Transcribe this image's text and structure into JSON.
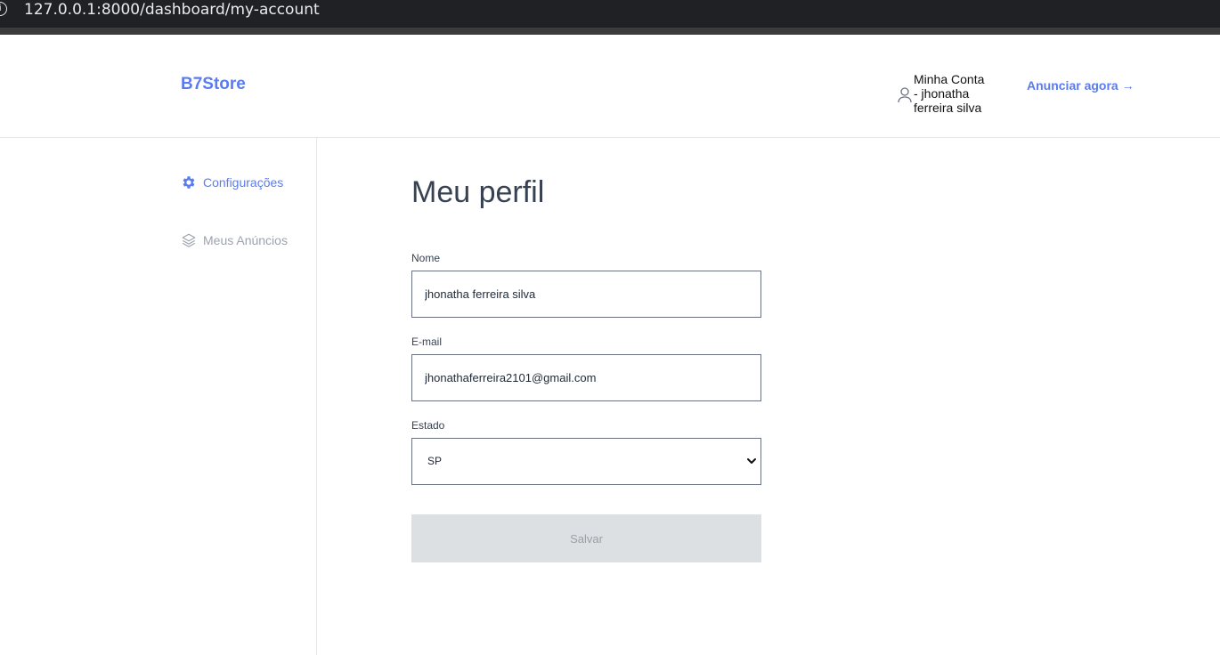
{
  "browser": {
    "url": "127.0.0.1:8000/dashboard/my-account"
  },
  "header": {
    "logo": "B7Store",
    "account_label": "Minha Conta - jhonatha ferreira silva",
    "announce_label": "Anunciar agora →"
  },
  "sidebar": {
    "items": [
      {
        "label": "Configurações",
        "icon": "gear-icon",
        "active": true
      },
      {
        "label": "Meus Anúncios",
        "icon": "layers-icon",
        "active": false
      }
    ]
  },
  "main": {
    "title": "Meu perfil",
    "fields": {
      "name": {
        "label": "Nome",
        "value": "jhonatha ferreira silva"
      },
      "email": {
        "label": "E-mail",
        "value": "jhonathaferreira2101@gmail.com"
      },
      "state": {
        "label": "Estado",
        "value": "SP"
      }
    },
    "save_label": "Salvar"
  },
  "colors": {
    "accent": "#5a7cf0",
    "muted": "#9ca3af",
    "button_disabled_bg": "#dde0e3"
  }
}
